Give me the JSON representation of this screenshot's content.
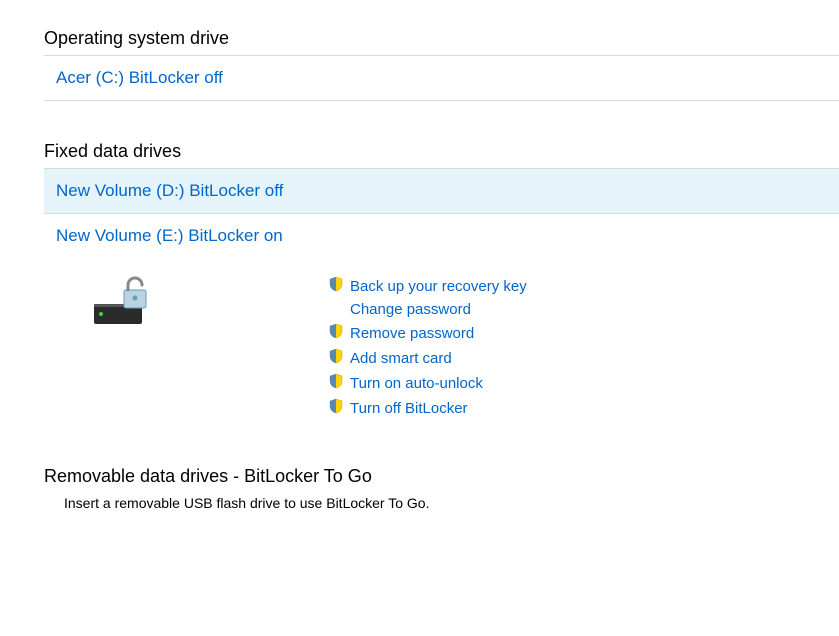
{
  "sections": {
    "os": {
      "header": "Operating system drive",
      "drive": "Acer (C:) BitLocker off"
    },
    "fixed": {
      "header": "Fixed data drives",
      "drive_d": "New Volume (D:) BitLocker off",
      "drive_e": "New Volume (E:) BitLocker on",
      "actions": {
        "backup": "Back up your recovery key",
        "change_pw": "Change password",
        "remove_pw": "Remove password",
        "smart_card": "Add smart card",
        "auto_unlock": "Turn on auto-unlock",
        "turn_off": "Turn off BitLocker"
      }
    },
    "removable": {
      "header": "Removable data drives - BitLocker To Go",
      "description": "Insert a removable USB flash drive to use BitLocker To Go."
    }
  }
}
